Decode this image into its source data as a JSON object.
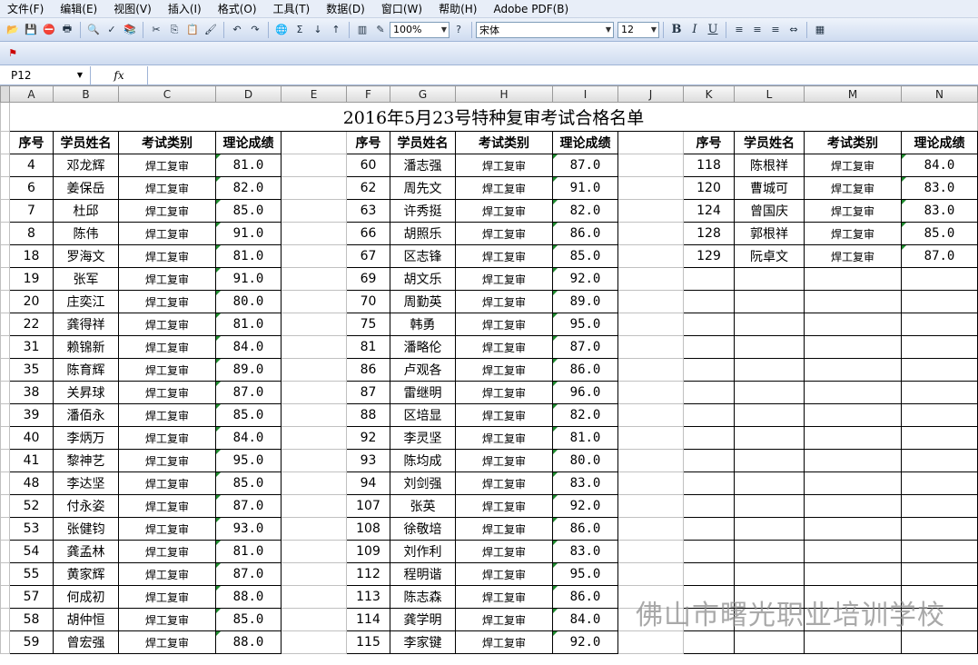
{
  "menu": [
    "文件(F)",
    "编辑(E)",
    "视图(V)",
    "插入(I)",
    "格式(O)",
    "工具(T)",
    "数据(D)",
    "窗口(W)",
    "帮助(H)",
    "Adobe PDF(B)"
  ],
  "toolbar": {
    "zoom": "100%",
    "font_name": "宋体",
    "font_size": "12",
    "bold": "B",
    "italic": "I",
    "underline": "U"
  },
  "formula_bar": {
    "cell_ref": "P12",
    "fx": "fx",
    "value": ""
  },
  "columns": [
    "A",
    "B",
    "C",
    "D",
    "E",
    "F",
    "G",
    "H",
    "I",
    "J",
    "K",
    "L",
    "M",
    "N"
  ],
  "sheet": {
    "title": "2016年5月23号特种复审考试合格名单",
    "headers": [
      "序号",
      "学员姓名",
      "考试类别",
      "理论成绩"
    ],
    "block1": [
      [
        "4",
        "邓龙辉",
        "焊工复审",
        "81.0"
      ],
      [
        "6",
        "姜保岳",
        "焊工复审",
        "82.0"
      ],
      [
        "7",
        "杜邱",
        "焊工复审",
        "85.0"
      ],
      [
        "8",
        "陈伟",
        "焊工复审",
        "91.0"
      ],
      [
        "18",
        "罗海文",
        "焊工复审",
        "81.0"
      ],
      [
        "19",
        "张军",
        "焊工复审",
        "91.0"
      ],
      [
        "20",
        "庄奕江",
        "焊工复审",
        "80.0"
      ],
      [
        "22",
        "龚得祥",
        "焊工复审",
        "81.0"
      ],
      [
        "31",
        "赖锦新",
        "焊工复审",
        "84.0"
      ],
      [
        "35",
        "陈育辉",
        "焊工复审",
        "89.0"
      ],
      [
        "38",
        "关昇球",
        "焊工复审",
        "87.0"
      ],
      [
        "39",
        "潘佰永",
        "焊工复审",
        "85.0"
      ],
      [
        "40",
        "李炳万",
        "焊工复审",
        "84.0"
      ],
      [
        "41",
        "黎神艺",
        "焊工复审",
        "95.0"
      ],
      [
        "48",
        "李达坚",
        "焊工复审",
        "85.0"
      ],
      [
        "52",
        "付永姿",
        "焊工复审",
        "87.0"
      ],
      [
        "53",
        "张健钧",
        "焊工复审",
        "93.0"
      ],
      [
        "54",
        "龚孟林",
        "焊工复审",
        "81.0"
      ],
      [
        "55",
        "黄家辉",
        "焊工复审",
        "87.0"
      ],
      [
        "57",
        "何成初",
        "焊工复审",
        "88.0"
      ],
      [
        "58",
        "胡仲恒",
        "焊工复审",
        "85.0"
      ],
      [
        "59",
        "曾宏强",
        "焊工复审",
        "88.0"
      ]
    ],
    "block2": [
      [
        "60",
        "潘志强",
        "焊工复审",
        "87.0"
      ],
      [
        "62",
        "周先文",
        "焊工复审",
        "91.0"
      ],
      [
        "63",
        "许秀挺",
        "焊工复审",
        "82.0"
      ],
      [
        "66",
        "胡照乐",
        "焊工复审",
        "86.0"
      ],
      [
        "67",
        "区志锋",
        "焊工复审",
        "85.0"
      ],
      [
        "69",
        "胡文乐",
        "焊工复审",
        "92.0"
      ],
      [
        "70",
        "周勤英",
        "焊工复审",
        "89.0"
      ],
      [
        "75",
        "韩勇",
        "焊工复审",
        "95.0"
      ],
      [
        "81",
        "潘略伦",
        "焊工复审",
        "87.0"
      ],
      [
        "86",
        "卢观各",
        "焊工复审",
        "86.0"
      ],
      [
        "87",
        "雷继明",
        "焊工复审",
        "96.0"
      ],
      [
        "88",
        "区培显",
        "焊工复审",
        "82.0"
      ],
      [
        "92",
        "李灵坚",
        "焊工复审",
        "81.0"
      ],
      [
        "93",
        "陈均成",
        "焊工复审",
        "80.0"
      ],
      [
        "94",
        "刘剑强",
        "焊工复审",
        "83.0"
      ],
      [
        "107",
        "张英",
        "焊工复审",
        "92.0"
      ],
      [
        "108",
        "徐敬培",
        "焊工复审",
        "86.0"
      ],
      [
        "109",
        "刘作利",
        "焊工复审",
        "83.0"
      ],
      [
        "112",
        "程明谐",
        "焊工复审",
        "95.0"
      ],
      [
        "113",
        "陈志森",
        "焊工复审",
        "86.0"
      ],
      [
        "114",
        "龚学明",
        "焊工复审",
        "84.0"
      ],
      [
        "115",
        "李家键",
        "焊工复审",
        "92.0"
      ]
    ],
    "block3": [
      [
        "118",
        "陈根祥",
        "焊工复审",
        "84.0"
      ],
      [
        "120",
        "曹城可",
        "焊工复审",
        "83.0"
      ],
      [
        "124",
        "曾国庆",
        "焊工复审",
        "83.0"
      ],
      [
        "128",
        "郭根祥",
        "焊工复审",
        "85.0"
      ],
      [
        "129",
        "阮卓文",
        "焊工复审",
        "87.0"
      ]
    ]
  },
  "watermark": "佛山市曙光职业培训学校"
}
